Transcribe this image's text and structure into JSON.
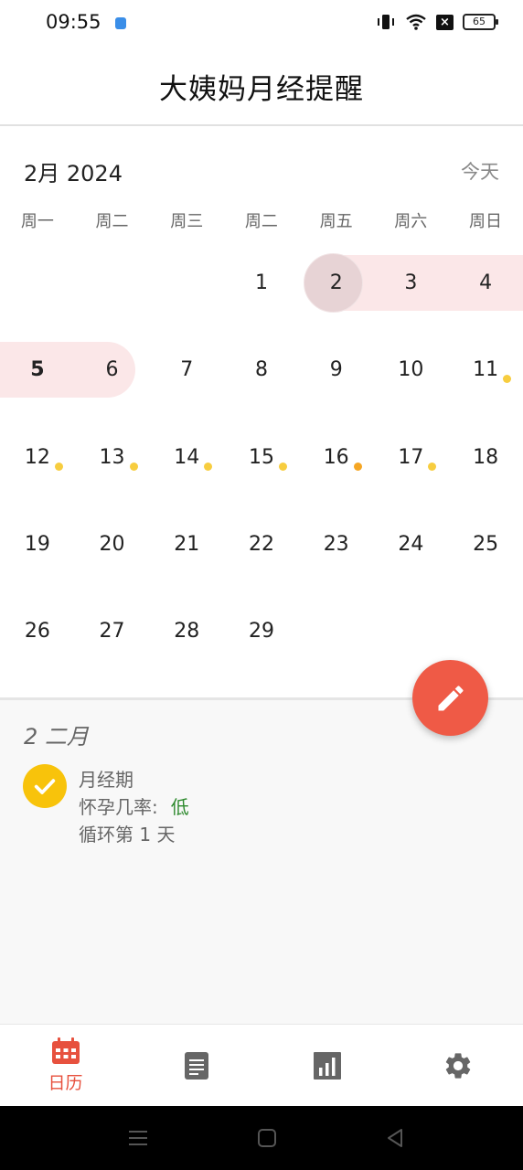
{
  "status_bar": {
    "time": "09:55",
    "battery": "65"
  },
  "app_bar": {
    "title": "大姨妈月经提醒"
  },
  "calendar": {
    "month_label": "2月 2024",
    "today_label": "今天",
    "weekdays": [
      "周一",
      "周二",
      "周三",
      "周二",
      "周五",
      "周六",
      "周日"
    ],
    "weeks": [
      [
        "",
        "",
        "",
        "1",
        "2",
        "3",
        "4"
      ],
      [
        "5",
        "6",
        "7",
        "8",
        "9",
        "10",
        "11"
      ],
      [
        "12",
        "13",
        "14",
        "15",
        "16",
        "17",
        "18"
      ],
      [
        "19",
        "20",
        "21",
        "22",
        "23",
        "24",
        "25"
      ],
      [
        "26",
        "27",
        "28",
        "29",
        "",
        "",
        ""
      ]
    ],
    "selected_day": "2",
    "period_days": [
      "2",
      "3",
      "4",
      "5",
      "6"
    ],
    "dot_days": [
      "11",
      "12",
      "13",
      "14",
      "15",
      "16",
      "17"
    ],
    "highlight_dot_day": "16",
    "colors": {
      "period": "#fbe7e8",
      "selected": "#e7d3d5",
      "dot": "#f7cd3f",
      "dot_highlight": "#f5a623"
    }
  },
  "fab": {
    "icon": "pencil-icon",
    "color": "#ef5a46"
  },
  "detail": {
    "date_label": "2 二月",
    "status_icon": "check-icon",
    "period_label": "月经期",
    "pregnancy_label": "怀孕几率:",
    "pregnancy_value": "低",
    "cycle_label": "循环第 1 天"
  },
  "bottom_nav": {
    "items": [
      {
        "icon": "calendar-icon",
        "label": "日历",
        "active": true
      },
      {
        "icon": "notes-icon",
        "label": "",
        "active": false
      },
      {
        "icon": "bar-chart-icon",
        "label": "",
        "active": false
      },
      {
        "icon": "gear-icon",
        "label": "",
        "active": false
      }
    ],
    "active_color": "#e7513e"
  }
}
